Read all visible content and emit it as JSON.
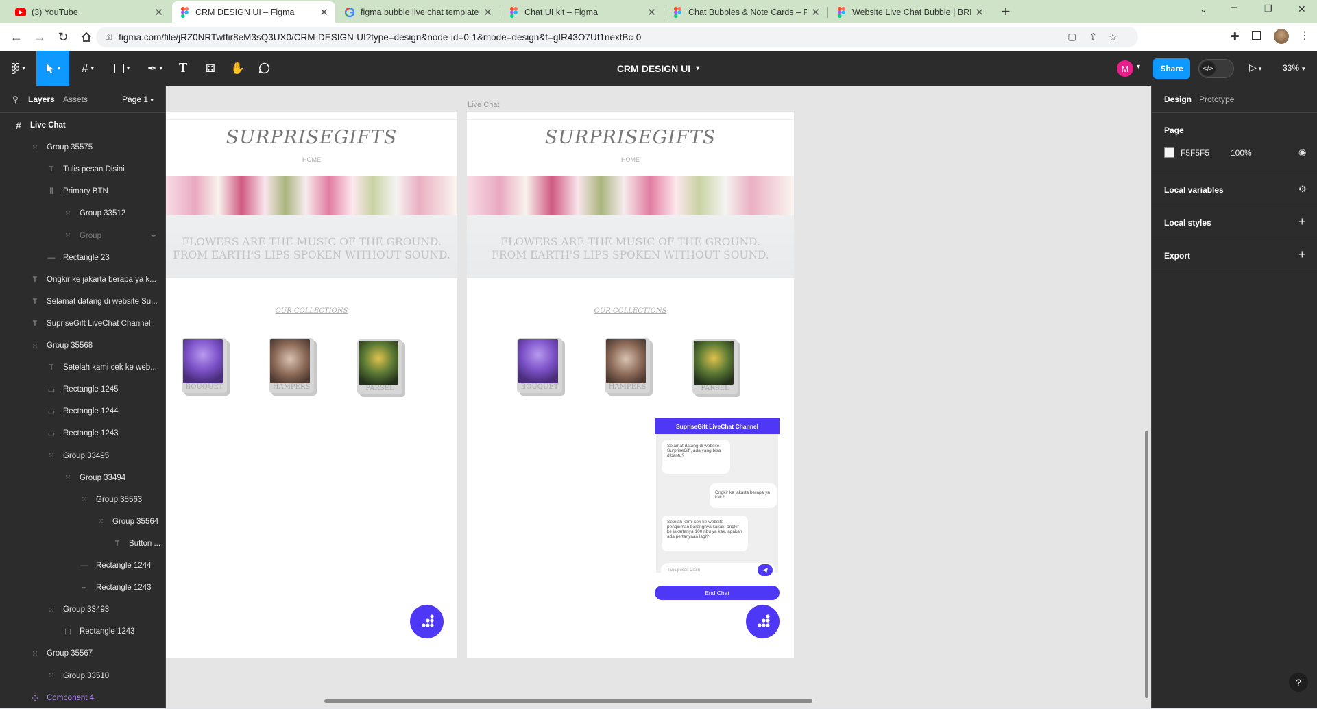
{
  "browser": {
    "tabs": [
      {
        "title": "(3) YouTube",
        "icon": "youtube-icon"
      },
      {
        "title": "CRM DESIGN UI – Figma",
        "icon": "figma-icon",
        "active": true
      },
      {
        "title": "figma bubble live chat template",
        "icon": "google-icon"
      },
      {
        "title": "Chat UI kit – Figma",
        "icon": "figma-icon"
      },
      {
        "title": "Chat Bubbles & Note Cards – Fig",
        "icon": "figma-icon"
      },
      {
        "title": "Website Live Chat Bubble | BRIX",
        "icon": "figma-icon"
      }
    ],
    "url": "figma.com/file/jRZ0NRTwtfir8eM3sQ3UX0/CRM-DESIGN-UI?type=design&node-id=0-1&mode=design&t=gIR43O7Uf1nextBc-0"
  },
  "toolbar": {
    "file_title": "CRM DESIGN UI",
    "avatar_letter": "M",
    "share_label": "Share",
    "zoom": "33%"
  },
  "left_panel": {
    "tab_layers": "Layers",
    "tab_assets": "Assets",
    "page_selector": "Page 1",
    "layers": [
      {
        "name": "Live Chat",
        "icon": "frame-icon",
        "indent": 0,
        "bold": true
      },
      {
        "name": "Group 35575",
        "icon": "group-icon",
        "indent": 1
      },
      {
        "name": "Tulis pesan Disini",
        "icon": "text-icon",
        "indent": 2
      },
      {
        "name": "Primary BTN",
        "icon": "autolayout-icon",
        "indent": 2
      },
      {
        "name": "Group 33512",
        "icon": "group-icon",
        "indent": 3
      },
      {
        "name": "Group",
        "icon": "group-icon",
        "indent": 3,
        "hidden": true
      },
      {
        "name": "Rectangle 23",
        "icon": "line-icon",
        "indent": 2
      },
      {
        "name": "Ongkir ke jakarta berapa ya k...",
        "icon": "text-icon",
        "indent": 1
      },
      {
        "name": "Selamat datang di website Su...",
        "icon": "text-icon",
        "indent": 1
      },
      {
        "name": "SupriseGift LiveChat Channel",
        "icon": "text-icon",
        "indent": 1
      },
      {
        "name": "Group 35568",
        "icon": "group-icon",
        "indent": 1
      },
      {
        "name": "Setelah kami cek ke web...",
        "icon": "text-icon",
        "indent": 2
      },
      {
        "name": "Rectangle 1245",
        "icon": "rect-icon",
        "indent": 2
      },
      {
        "name": "Rectangle 1244",
        "icon": "rect-icon",
        "indent": 2
      },
      {
        "name": "Rectangle 1243",
        "icon": "rect-icon",
        "indent": 2
      },
      {
        "name": "Group 33495",
        "icon": "group-icon",
        "indent": 2
      },
      {
        "name": "Group 33494",
        "icon": "group-icon",
        "indent": 3
      },
      {
        "name": "Group 35563",
        "icon": "group-icon",
        "indent": 4
      },
      {
        "name": "Group 35564",
        "icon": "group-icon",
        "indent": 5
      },
      {
        "name": "Button ...",
        "icon": "text-icon",
        "indent": 6
      },
      {
        "name": "Rectangle 1244",
        "icon": "line-icon",
        "indent": 4
      },
      {
        "name": "Rectangle 1243",
        "icon": "dash-icon",
        "indent": 4
      },
      {
        "name": "Group 33493",
        "icon": "group-icon",
        "indent": 2
      },
      {
        "name": "Rectangle 1243",
        "icon": "square-icon",
        "indent": 3
      },
      {
        "name": "Group 35567",
        "icon": "group-icon",
        "indent": 1
      },
      {
        "name": "Group 33510",
        "icon": "group-icon",
        "indent": 2
      },
      {
        "name": "Component 4",
        "icon": "component-icon",
        "indent": 1,
        "component": true
      }
    ]
  },
  "canvas": {
    "frame_label": "Live Chat",
    "site": {
      "brand": "SURPRISEGIFTS",
      "nav_home": "HOME",
      "quote_line1": "FLOWERS ARE THE MUSIC OF THE GROUND.",
      "quote_line2": "FROM EARTH'S LIPS SPOKEN WITHOUT SOUND.",
      "collections_title": "OUR COLLECTIONS",
      "collections": [
        "BOUQUET",
        "HAMPERS",
        "PARSEL"
      ]
    },
    "chat": {
      "header": "SupriseGift LiveChat Channel",
      "msg1": "Selamat datang di website SurpriseGift, ada yang bisa dibantu?",
      "msg2": "Ongkir ke jakarta berapa ya kak?",
      "msg3": "Setelah kami cek ke website pengiriman barangnya kakak, ongkir ke jakartanya 100 ribu ya kak, apakah ada pertanyaan lagi?",
      "input_placeholder": "Tulis pesan Disini",
      "end_chat": "End Chat"
    }
  },
  "right_panel": {
    "tab_design": "Design",
    "tab_prototype": "Prototype",
    "page_section": "Page",
    "page_color": "F5F5F5",
    "page_opacity": "100%",
    "local_variables": "Local variables",
    "local_styles": "Local styles",
    "export": "Export",
    "help": "?"
  },
  "colors": {
    "accent": "#4f38f5",
    "figma_blue": "#0d99ff",
    "share_blue": "#0d99ff",
    "avatar_pink": "#e91e8c",
    "component_purple": "#b88cff"
  }
}
